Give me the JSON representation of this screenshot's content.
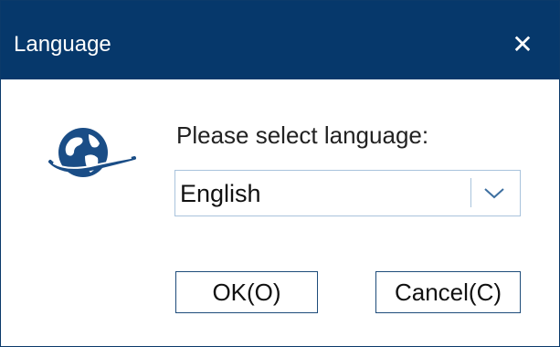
{
  "dialog": {
    "title": "Language",
    "close_glyph": "✕",
    "icon": "globe-icon",
    "prompt": "Please select language:",
    "language_select": {
      "selected": "English"
    },
    "ok_label": "OK(O)",
    "cancel_label": "Cancel(C)"
  },
  "colors": {
    "titlebar": "#06386b",
    "globe": "#1a4d86",
    "border": "#a9c3dc"
  }
}
